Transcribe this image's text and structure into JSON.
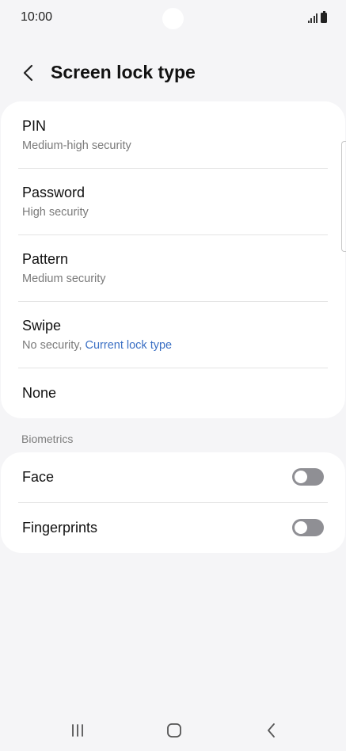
{
  "status_bar": {
    "time": "10:00"
  },
  "header": {
    "title": "Screen lock type",
    "back_icon": "chevron-left-icon"
  },
  "lock_options": [
    {
      "title": "PIN",
      "subtitle": "Medium-high security"
    },
    {
      "title": "Password",
      "subtitle": "High security"
    },
    {
      "title": "Pattern",
      "subtitle": "Medium security"
    },
    {
      "title": "Swipe",
      "subtitle": "No security, ",
      "subtitle_highlight": "Current lock type"
    },
    {
      "title": "None"
    }
  ],
  "biometrics": {
    "section_label": "Biometrics",
    "items": [
      {
        "title": "Face",
        "enabled": false
      },
      {
        "title": "Fingerprints",
        "enabled": false
      }
    ]
  },
  "colors": {
    "background": "#f5f5f7",
    "card": "#ffffff",
    "accent_link": "#3a6fc4",
    "toggle_off": "#8f8f94"
  },
  "nav_bar": {
    "recents_icon": "recents-icon",
    "home_icon": "home-icon",
    "back_icon": "back-nav-icon"
  }
}
